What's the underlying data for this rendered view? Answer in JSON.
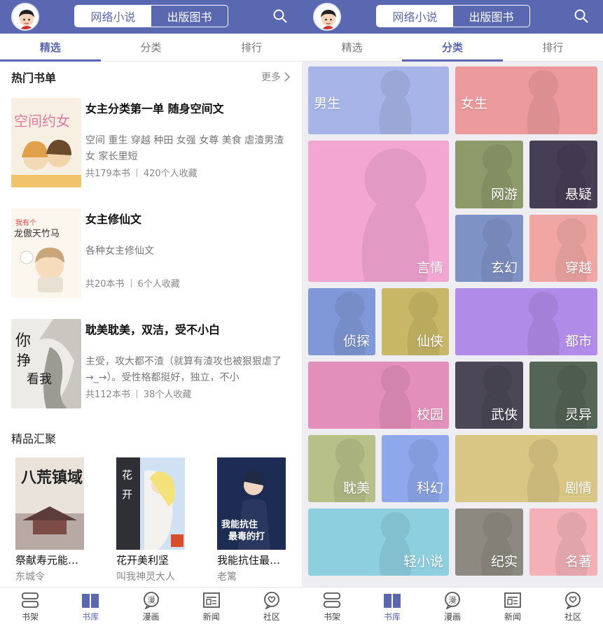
{
  "left": {
    "header": {
      "seg_web": "网络小说",
      "seg_pub": "出版图书"
    },
    "tabs": [
      "精选",
      "分类",
      "排行"
    ],
    "hot_section": {
      "title": "热门书单",
      "more": "更多"
    },
    "booklists": [
      {
        "title": "女主分类第一单 随身空间文",
        "desc": "空间 重生 穿越 种田 女强 女尊 美食 虐渣男渣女 家长里短",
        "books": "共179本书",
        "favs": "420个人收藏",
        "cover_text": "空间约女"
      },
      {
        "title": "女主修仙文",
        "desc": "各种女主修仙文",
        "books": "共20本书",
        "favs": "6个人收藏",
        "cover_text": "我有个龙傲天竹马"
      },
      {
        "title": "耽美耽美，双洁，受不小白",
        "desc": "主受，攻大都不渣（就算有渣攻也被狠狠虐了→_→）。受性格都挺好，独立，不小",
        "books": "共112本书",
        "favs": "38个人收藏",
        "cover_text": "你挣扎看我"
      }
    ],
    "premium_section": {
      "title": "精品汇聚"
    },
    "premium": [
      {
        "name": "祭献寿元能…",
        "author": "东城令",
        "cover_text": "八荒镇域"
      },
      {
        "name": "花开美利坚",
        "author": "叫我神灵大人",
        "cover_text": "花开"
      },
      {
        "name": "我能抗住最…",
        "author": "老篱",
        "cover_text": "我能抗住最毒的打"
      }
    ]
  },
  "right": {
    "header": {
      "seg_web": "网络小说",
      "seg_pub": "出版图书"
    },
    "tabs": [
      "精选",
      "分类",
      "排行"
    ],
    "categories": [
      {
        "label": "男生",
        "color": "#a7b4e8"
      },
      {
        "label": "女生",
        "color": "#ec9a9c"
      },
      {
        "label": "言情",
        "color": "#f4a6d3"
      },
      {
        "label": "网游",
        "color": "#8d9a6a"
      },
      {
        "label": "悬疑",
        "color": "#463e55"
      },
      {
        "label": "玄幻",
        "color": "#7f92c6"
      },
      {
        "label": "穿越",
        "color": "#f0a7a3"
      },
      {
        "label": "侦探",
        "color": "#8198d8"
      },
      {
        "label": "仙侠",
        "color": "#c8b766"
      },
      {
        "label": "都市",
        "color": "#b18be8"
      },
      {
        "label": "校园",
        "color": "#e38fbb"
      },
      {
        "label": "武侠",
        "color": "#4b4757"
      },
      {
        "label": "灵异",
        "color": "#546456"
      },
      {
        "label": "耽美",
        "color": "#b6c088"
      },
      {
        "label": "科幻",
        "color": "#8fa8ec"
      },
      {
        "label": "剧情",
        "color": "#d9c684"
      },
      {
        "label": "轻小说",
        "color": "#8dcfdf"
      },
      {
        "label": "纪实",
        "color": "#8c8a80"
      },
      {
        "label": "名著",
        "color": "#f3b1b7"
      }
    ]
  },
  "bottom_nav": [
    "书架",
    "书库",
    "漫画",
    "新闻",
    "社区"
  ],
  "colors": {
    "brand": "#5a67b1"
  }
}
